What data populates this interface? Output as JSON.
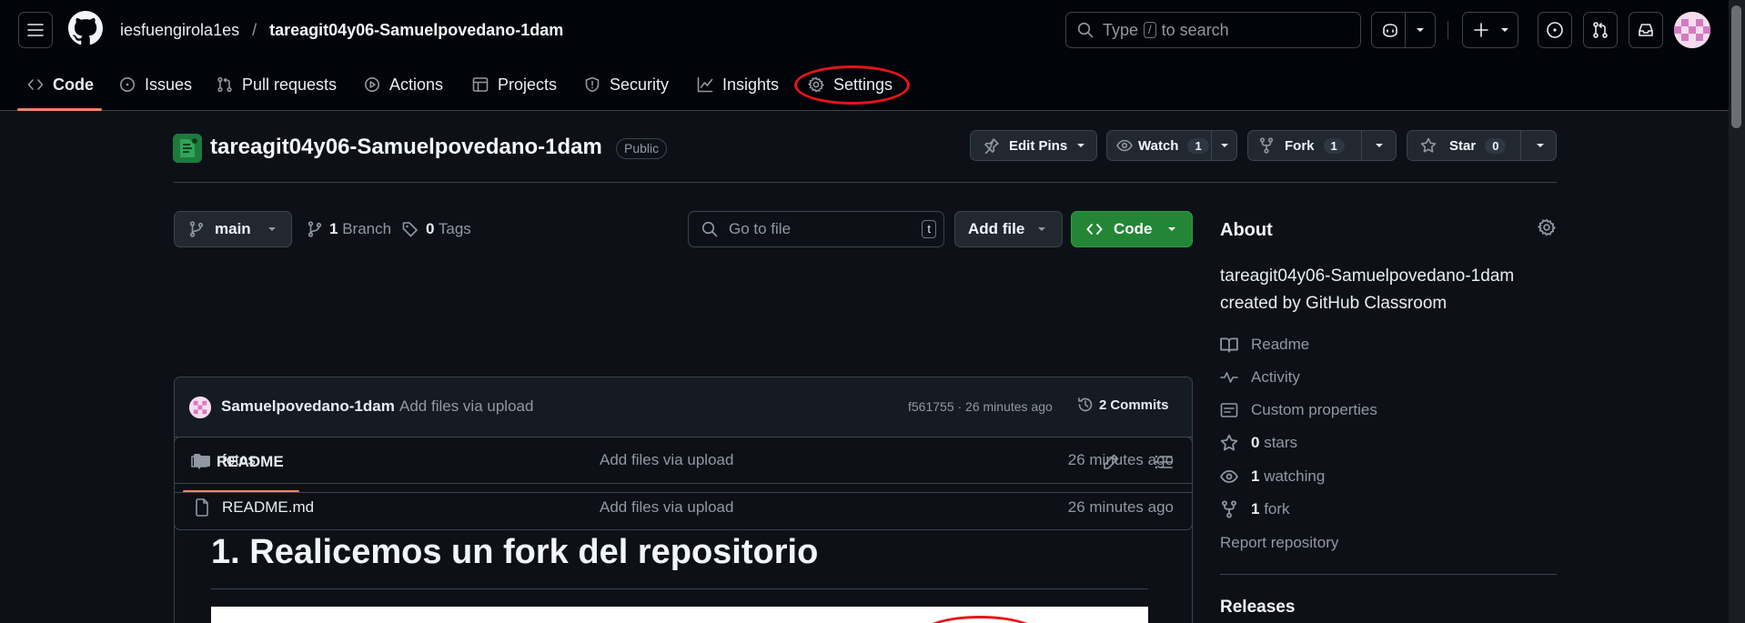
{
  "header": {
    "owner": "iesfuengirola1es",
    "separator": "/",
    "repo": "tareagit04y06-Samuelpovedano-1dam",
    "search": {
      "placeholder_pre": "Type",
      "slash_key": "/",
      "placeholder_post": "to search"
    }
  },
  "repo_nav": {
    "tabs": [
      {
        "label": "Code",
        "icon": "code-icon",
        "selected": true
      },
      {
        "label": "Issues",
        "icon": "issue-icon"
      },
      {
        "label": "Pull requests",
        "icon": "pull-request-icon"
      },
      {
        "label": "Actions",
        "icon": "play-icon"
      },
      {
        "label": "Projects",
        "icon": "table-icon"
      },
      {
        "label": "Security",
        "icon": "shield-icon"
      },
      {
        "label": "Insights",
        "icon": "graph-icon"
      },
      {
        "label": "Settings",
        "icon": "gear-icon",
        "annotated": true
      }
    ],
    "annotation_color": "#e5141b"
  },
  "repo_header": {
    "title": "tareagit04y06-Samuelpovedano-1dam",
    "visibility": "Public",
    "edit_pins": "Edit Pins",
    "watch": {
      "label": "Watch",
      "count": "1"
    },
    "fork": {
      "label": "Fork",
      "count": "1"
    },
    "star": {
      "label": "Star",
      "count": "0"
    }
  },
  "toolbar": {
    "branch": "main",
    "branches": {
      "count": "1",
      "label": "Branch"
    },
    "tags": {
      "count": "0",
      "label": "Tags"
    },
    "goto_placeholder": "Go to file",
    "goto_key": "t",
    "add_file": "Add file",
    "code": "Code",
    "code_color": "#238636"
  },
  "commit": {
    "author": "Samuelpovedano-1dam",
    "message": "Add files via upload",
    "hash_time": "f561755 · 26 minutes ago",
    "commits_count": "2",
    "commits_label": "Commits"
  },
  "files": [
    {
      "name": "fotos",
      "type": "folder",
      "message": "Add files via upload",
      "time": "26 minutes ago"
    },
    {
      "name": "README.md",
      "type": "file",
      "message": "Add files via upload",
      "time": "26 minutes ago"
    }
  ],
  "readme": {
    "tab_label": "README",
    "heading": "1. Realicemos un fork del repositorio"
  },
  "about": {
    "title": "About",
    "description": "tareagit04y06-Samuelpovedano-1dam created by GitHub Classroom",
    "items": [
      {
        "icon": "book-icon",
        "bold": "",
        "text": "Readme"
      },
      {
        "icon": "pulse-icon",
        "bold": "",
        "text": "Activity"
      },
      {
        "icon": "note-icon",
        "bold": "",
        "text": "Custom properties"
      },
      {
        "icon": "star-icon",
        "bold": "0",
        "text": "stars"
      },
      {
        "icon": "eye-icon",
        "bold": "1",
        "text": "watching"
      },
      {
        "icon": "fork-icon",
        "bold": "1",
        "text": "fork"
      }
    ],
    "report": "Report repository",
    "releases": "Releases"
  }
}
